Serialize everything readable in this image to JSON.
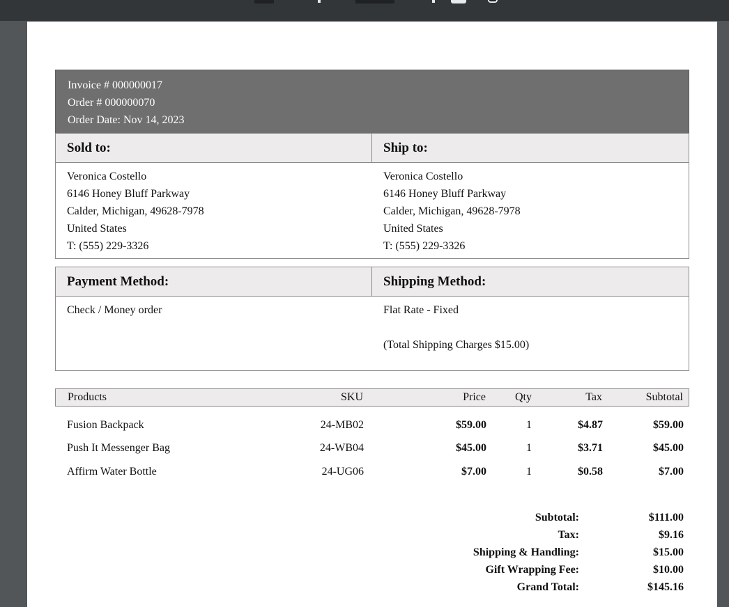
{
  "header": {
    "invoice": "Invoice # 000000017",
    "order": "Order # 000000070",
    "order_date": "Order Date: Nov 14, 2023"
  },
  "address": {
    "sold_to_label": "Sold to:",
    "ship_to_label": "Ship to:",
    "sold_to": [
      "Veronica Costello",
      "6146 Honey Bluff Parkway",
      "Calder, Michigan, 49628-7978",
      "United States",
      "T: (555) 229-3326"
    ],
    "ship_to": [
      "Veronica Costello",
      "6146 Honey Bluff Parkway",
      "Calder, Michigan, 49628-7978",
      "United States",
      "T: (555) 229-3326"
    ]
  },
  "methods": {
    "payment_label": "Payment Method:",
    "shipping_label": "Shipping Method:",
    "payment": "Check / Money order",
    "shipping": "Flat Rate - Fixed",
    "shipping_charges": "(Total Shipping Charges $15.00)"
  },
  "items": {
    "headers": {
      "products": "Products",
      "sku": "SKU",
      "price": "Price",
      "qty": "Qty",
      "tax": "Tax",
      "subtotal": "Subtotal"
    },
    "rows": [
      {
        "product": "Fusion Backpack",
        "sku": "24-MB02",
        "price": "$59.00",
        "qty": "1",
        "tax": "$4.87",
        "subtotal": "$59.00"
      },
      {
        "product": "Push It Messenger Bag",
        "sku": "24-WB04",
        "price": "$45.00",
        "qty": "1",
        "tax": "$3.71",
        "subtotal": "$45.00"
      },
      {
        "product": "Affirm Water Bottle",
        "sku": "24-UG06",
        "price": "$7.00",
        "qty": "1",
        "tax": "$0.58",
        "subtotal": "$7.00"
      }
    ]
  },
  "totals": [
    {
      "label": "Subtotal:",
      "value": "$111.00"
    },
    {
      "label": "Tax:",
      "value": "$9.16"
    },
    {
      "label": "Shipping & Handling:",
      "value": "$15.00"
    },
    {
      "label": "Gift Wrapping Fee:",
      "value": "$10.00"
    },
    {
      "label": "Grand Total:",
      "value": "$145.16"
    }
  ]
}
